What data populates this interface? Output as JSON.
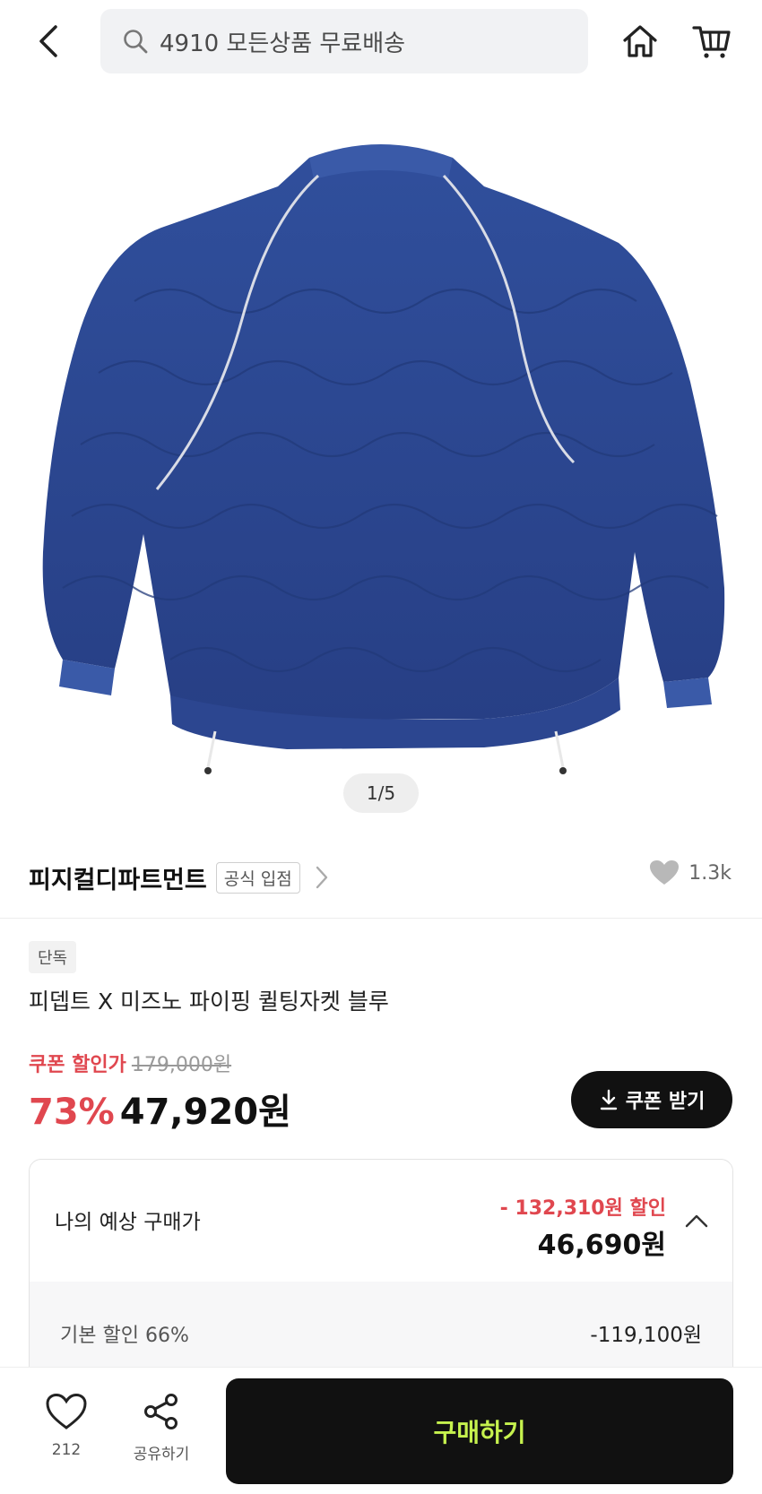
{
  "header": {
    "search_text": "4910 모든상품 무료배송"
  },
  "image": {
    "counter": "1/5",
    "subject": "Blue quilted jacket (back view)",
    "colors": {
      "jacket": "#2b4a96",
      "piping": "#d9dce6"
    }
  },
  "brand": {
    "name": "피지컬디파트먼트",
    "badge": "공식 입점",
    "like_count": "1.3k"
  },
  "product": {
    "tag": "단독",
    "title": "피뎁트 X 미즈노 파이핑 퀼팅자켓 블루"
  },
  "price": {
    "coupon_label": "쿠폰 할인가",
    "original": "179,000원",
    "discount_rate": "73%",
    "final": "47,920원",
    "coupon_button": "쿠폰 받기"
  },
  "estimate": {
    "label": "나의 예상 구매가",
    "discount": "- 132,310원 할인",
    "price": "46,690원",
    "base_label": "기본 할인 66%",
    "base_value": "-119,100원"
  },
  "bottom": {
    "like_count": "212",
    "share_label": "공유하기",
    "buy_label": "구매하기"
  },
  "colors": {
    "accent_red": "#e0474f",
    "buy_text": "#c6f24e",
    "dark": "#111111"
  }
}
